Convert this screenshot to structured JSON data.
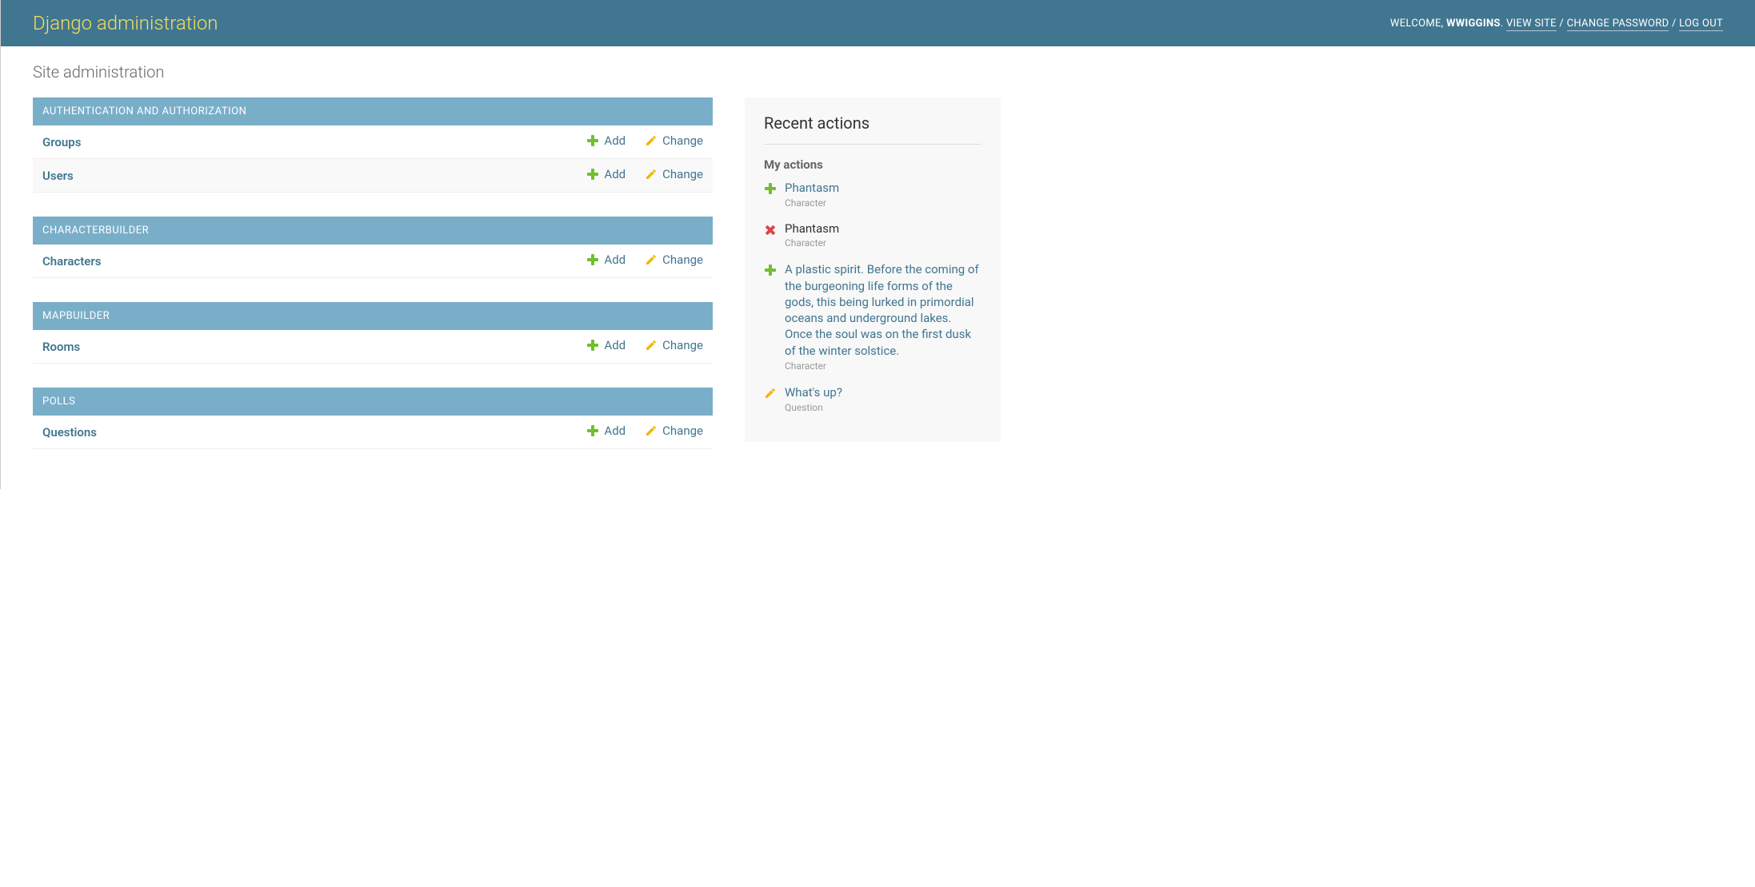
{
  "header": {
    "branding": "Django administration",
    "welcome_label": "WELCOME, ",
    "username": "WWIGGINS",
    "view_site_label": "VIEW SITE",
    "change_password_label": "CHANGE PASSWORD",
    "logout_label": "LOG OUT",
    "separator": " / ",
    "period": ". "
  },
  "page_title": "Site administration",
  "action_labels": {
    "add": "Add",
    "change": "Change"
  },
  "apps": [
    {
      "name": "AUTHENTICATION AND AUTHORIZATION",
      "models": [
        {
          "name": "Groups"
        },
        {
          "name": "Users"
        }
      ]
    },
    {
      "name": "CHARACTERBUILDER",
      "models": [
        {
          "name": "Characters"
        }
      ]
    },
    {
      "name": "MAPBUILDER",
      "models": [
        {
          "name": "Rooms"
        }
      ]
    },
    {
      "name": "POLLS",
      "models": [
        {
          "name": "Questions"
        }
      ]
    }
  ],
  "recent_actions": {
    "heading": "Recent actions",
    "subheading": "My actions",
    "entries": [
      {
        "action": "add",
        "title": "Phantasm",
        "type": "Character"
      },
      {
        "action": "delete",
        "title": "Phantasm",
        "type": "Character"
      },
      {
        "action": "add",
        "title": "A plastic spirit. Before the coming of the burgeoning life forms of the gods, this being lurked in primordial oceans and underground lakes. Once the soul was on the first dusk of the winter solstice.",
        "type": "Character"
      },
      {
        "action": "change",
        "title": "What's up?",
        "type": "Question"
      }
    ]
  }
}
